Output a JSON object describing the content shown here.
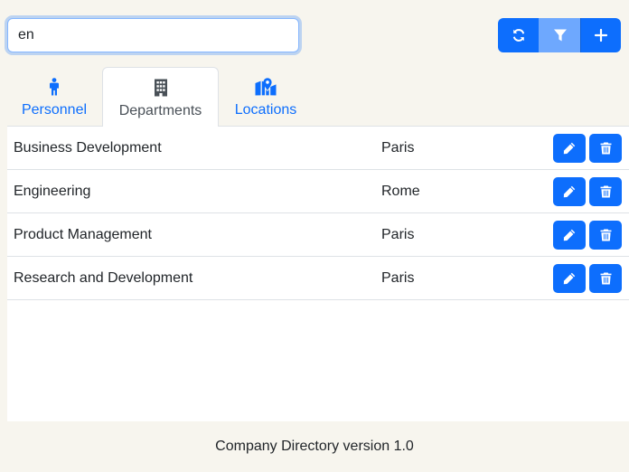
{
  "search": {
    "value": "en",
    "placeholder": ""
  },
  "toolbar": {
    "refresh_icon": "refresh-icon",
    "filter_icon": "filter-icon",
    "add_icon": "plus-icon",
    "active_button": "filter"
  },
  "tabs": [
    {
      "label": "Personnel",
      "icon": "person-icon",
      "active": false
    },
    {
      "label": "Departments",
      "icon": "building-icon",
      "active": true
    },
    {
      "label": "Locations",
      "icon": "map-location-icon",
      "active": false
    }
  ],
  "departments": [
    {
      "name": "Business Development",
      "location": "Paris"
    },
    {
      "name": "Engineering",
      "location": "Rome"
    },
    {
      "name": "Product Management",
      "location": "Paris"
    },
    {
      "name": "Research and Development",
      "location": "Paris"
    }
  ],
  "footer": {
    "text": "Company Directory version 1.0"
  },
  "colors": {
    "primary": "#0d6efd",
    "primary_active": "#6ea8fe",
    "background": "#f7f5ee",
    "border": "#dee2e6"
  }
}
